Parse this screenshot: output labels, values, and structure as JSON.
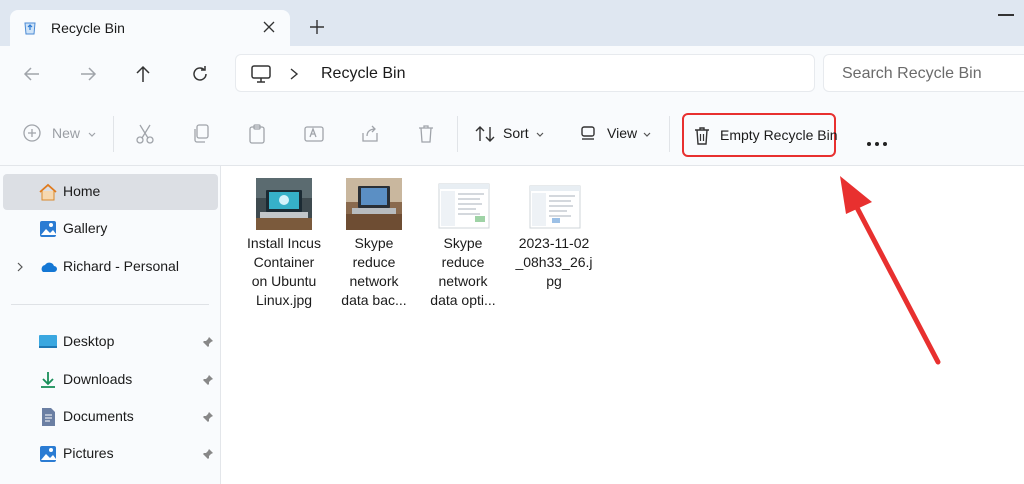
{
  "window": {
    "tab": {
      "title": "Recycle Bin",
      "icon": "recycle-bin-icon"
    },
    "new_tab_icon": "plus-icon",
    "accent": "#e8302f"
  },
  "address_bar": {
    "breadcrumb": [
      "Recycle Bin"
    ],
    "location_icon": "this-pc-icon",
    "search_placeholder": "Search Recycle Bin"
  },
  "toolbar": {
    "new_label": "New",
    "sort_label": "Sort",
    "view_label": "View",
    "empty_label": "Empty Recycle Bin",
    "more_icon": "more-icon"
  },
  "sidebar": {
    "top": [
      {
        "label": "Home",
        "icon": "home-icon",
        "selected": true
      },
      {
        "label": "Gallery",
        "icon": "gallery-icon"
      },
      {
        "label": "Richard - Personal",
        "icon": "onedrive-icon"
      }
    ],
    "quick_access": [
      {
        "label": "Desktop",
        "icon": "desktop-icon",
        "pinned": true
      },
      {
        "label": "Downloads",
        "icon": "download-icon",
        "pinned": true
      },
      {
        "label": "Documents",
        "icon": "documents-icon",
        "pinned": true
      },
      {
        "label": "Pictures",
        "icon": "pictures-icon",
        "pinned": true
      }
    ]
  },
  "files": [
    {
      "name": "Install Incus\nContainer\non Ubuntu\nLinux.jpg"
    },
    {
      "name": "Skype\nreduce\nnetwork\ndata bac..."
    },
    {
      "name": "Skype\nreduce\nnetwork\ndata opti..."
    },
    {
      "name": "2023-11-02\n_08h33_26.j\npg"
    }
  ]
}
